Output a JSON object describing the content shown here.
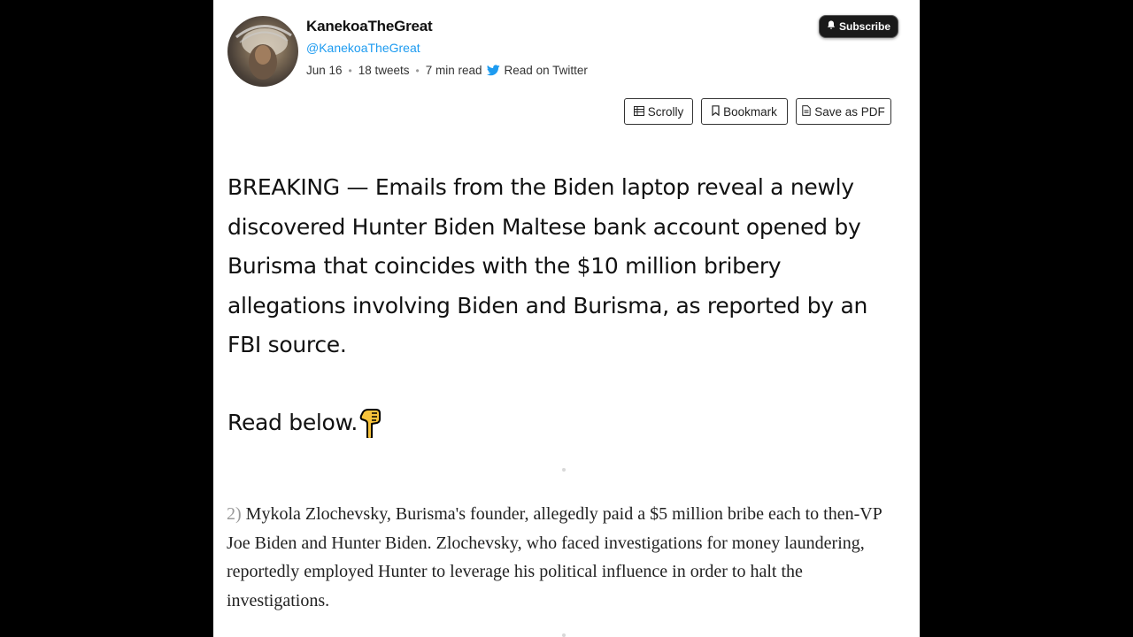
{
  "author": {
    "name": "KanekoaTheGreat",
    "handle": "@KanekoaTheGreat"
  },
  "meta": {
    "date": "Jun 16",
    "tweets": "18 tweets",
    "read_time": "7 min read",
    "read_on": "Read on Twitter"
  },
  "buttons": {
    "subscribe": "Subscribe",
    "scrolly": "Scrolly",
    "bookmark": "Bookmark",
    "save_pdf": "Save as PDF"
  },
  "thread": {
    "main_text": "BREAKING — Emails from the Biden laptop reveal a newly discovered Hunter Biden Maltese bank account opened by Burisma that coincides with the $10 million bribery allegations involving Biden and Burisma, as reported by an FBI source.",
    "read_below": "Read below.",
    "tweet2_num": "2)",
    "tweet2_text": "Mykola Zlochevsky, Burisma's founder, allegedly paid a $5 million bribe each to then-VP Joe Biden and Hunter Biden. Zlochevsky, who faced investigations for money laundering, reportedly employed Hunter to leverage his political influence in order to halt the investigations."
  },
  "colors": {
    "twitter_blue": "#1d9bf0",
    "subscribe_bg": "#1a1a1a"
  },
  "icons": [
    "bell-icon",
    "twitter-bird-icon",
    "scrolly-icon",
    "bookmark-icon",
    "pdf-icon",
    "pointing-down-emoji"
  ]
}
